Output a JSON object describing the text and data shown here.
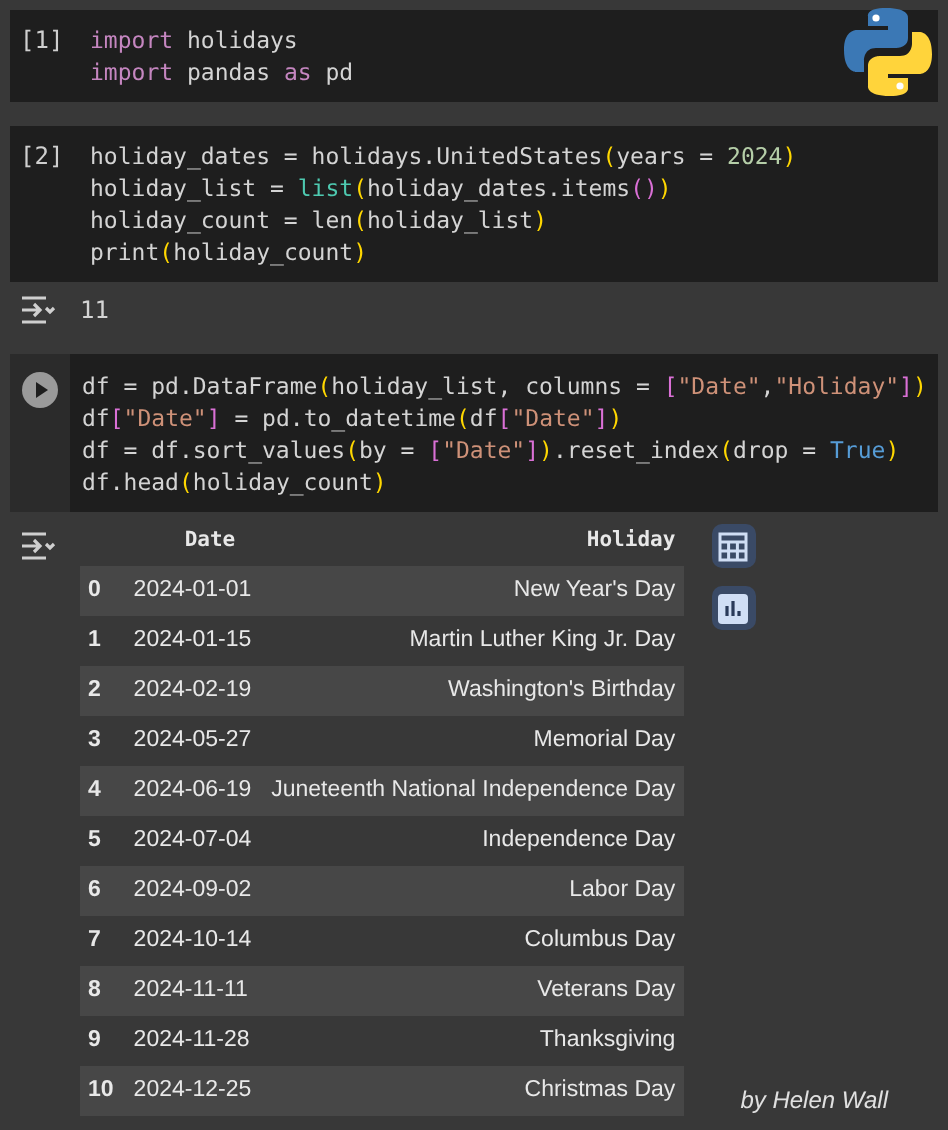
{
  "cells": [
    {
      "kind": "code",
      "prompt": "[1]",
      "lines": [
        [
          {
            "kind": "kw",
            "text": "import"
          },
          {
            "kind": "p",
            "text": " holidays"
          }
        ],
        [
          {
            "kind": "kw",
            "text": "import"
          },
          {
            "kind": "p",
            "text": " pandas "
          },
          {
            "kind": "kw",
            "text": "as"
          },
          {
            "kind": "p",
            "text": " pd"
          }
        ]
      ]
    },
    {
      "kind": "code",
      "prompt": "[2]",
      "lines": [
        [
          {
            "kind": "p",
            "text": "holiday_dates = holidays.UnitedStates"
          },
          {
            "kind": "br",
            "text": "("
          },
          {
            "kind": "p",
            "text": "years = "
          },
          {
            "kind": "num",
            "text": "2024"
          },
          {
            "kind": "br",
            "text": ")"
          }
        ],
        [
          {
            "kind": "p",
            "text": "holiday_list = "
          },
          {
            "kind": "fn",
            "text": "list"
          },
          {
            "kind": "br",
            "text": "("
          },
          {
            "kind": "p",
            "text": "holiday_dates.items"
          },
          {
            "kind": "sq",
            "text": "()"
          },
          {
            "kind": "br",
            "text": ")"
          }
        ],
        [
          {
            "kind": "p",
            "text": "holiday_count = len"
          },
          {
            "kind": "br",
            "text": "("
          },
          {
            "kind": "p",
            "text": "holiday_list"
          },
          {
            "kind": "br",
            "text": ")"
          }
        ],
        [
          {
            "kind": "p",
            "text": "print"
          },
          {
            "kind": "br",
            "text": "("
          },
          {
            "kind": "p",
            "text": "holiday_count"
          },
          {
            "kind": "br",
            "text": ")"
          }
        ]
      ]
    },
    {
      "kind": "text_output",
      "text": "11"
    },
    {
      "kind": "code",
      "run_button": true,
      "lines": [
        [
          {
            "kind": "p",
            "text": "df = pd.DataFrame"
          },
          {
            "kind": "br",
            "text": "("
          },
          {
            "kind": "p",
            "text": "holiday_list, columns = "
          },
          {
            "kind": "sq",
            "text": "["
          },
          {
            "kind": "str",
            "text": "\"Date\""
          },
          {
            "kind": "p",
            "text": ","
          },
          {
            "kind": "str",
            "text": "\"Holiday\""
          },
          {
            "kind": "sq",
            "text": "]"
          },
          {
            "kind": "br",
            "text": ")"
          }
        ],
        [
          {
            "kind": "p",
            "text": "df"
          },
          {
            "kind": "sq",
            "text": "["
          },
          {
            "kind": "str",
            "text": "\"Date\""
          },
          {
            "kind": "sq",
            "text": "]"
          },
          {
            "kind": "p",
            "text": " = pd.to_datetime"
          },
          {
            "kind": "br",
            "text": "("
          },
          {
            "kind": "p",
            "text": "df"
          },
          {
            "kind": "sq",
            "text": "["
          },
          {
            "kind": "str",
            "text": "\"Date\""
          },
          {
            "kind": "sq",
            "text": "]"
          },
          {
            "kind": "br",
            "text": ")"
          }
        ],
        [
          {
            "kind": "p",
            "text": "df = df.sort_values"
          },
          {
            "kind": "br",
            "text": "("
          },
          {
            "kind": "p",
            "text": "by = "
          },
          {
            "kind": "sq",
            "text": "["
          },
          {
            "kind": "str",
            "text": "\"Date\""
          },
          {
            "kind": "sq",
            "text": "]"
          },
          {
            "kind": "br",
            "text": ")"
          },
          {
            "kind": "p",
            "text": ".reset_index"
          },
          {
            "kind": "br",
            "text": "("
          },
          {
            "kind": "p",
            "text": "drop = "
          },
          {
            "kind": "const",
            "text": "True"
          },
          {
            "kind": "br",
            "text": ")"
          }
        ],
        [
          {
            "kind": "p",
            "text": "df.head"
          },
          {
            "kind": "br",
            "text": "("
          },
          {
            "kind": "p",
            "text": "holiday_count"
          },
          {
            "kind": "br",
            "text": ")"
          }
        ]
      ]
    },
    {
      "kind": "table_output",
      "columns": [
        "",
        "Date",
        "Holiday"
      ],
      "rows": [
        [
          "0",
          "2024-01-01",
          "New Year's Day"
        ],
        [
          "1",
          "2024-01-15",
          "Martin Luther King Jr. Day"
        ],
        [
          "2",
          "2024-02-19",
          "Washington's Birthday"
        ],
        [
          "3",
          "2024-05-27",
          "Memorial Day"
        ],
        [
          "4",
          "2024-06-19",
          "Juneteenth National Independence Day"
        ],
        [
          "5",
          "2024-07-04",
          "Independence Day"
        ],
        [
          "6",
          "2024-09-02",
          "Labor Day"
        ],
        [
          "7",
          "2024-10-14",
          "Columbus Day"
        ],
        [
          "8",
          "2024-11-11",
          "Veterans Day"
        ],
        [
          "9",
          "2024-11-28",
          "Thanksgiving"
        ],
        [
          "10",
          "2024-12-25",
          "Christmas Day"
        ]
      ]
    }
  ],
  "credit": "by Helen Wall"
}
